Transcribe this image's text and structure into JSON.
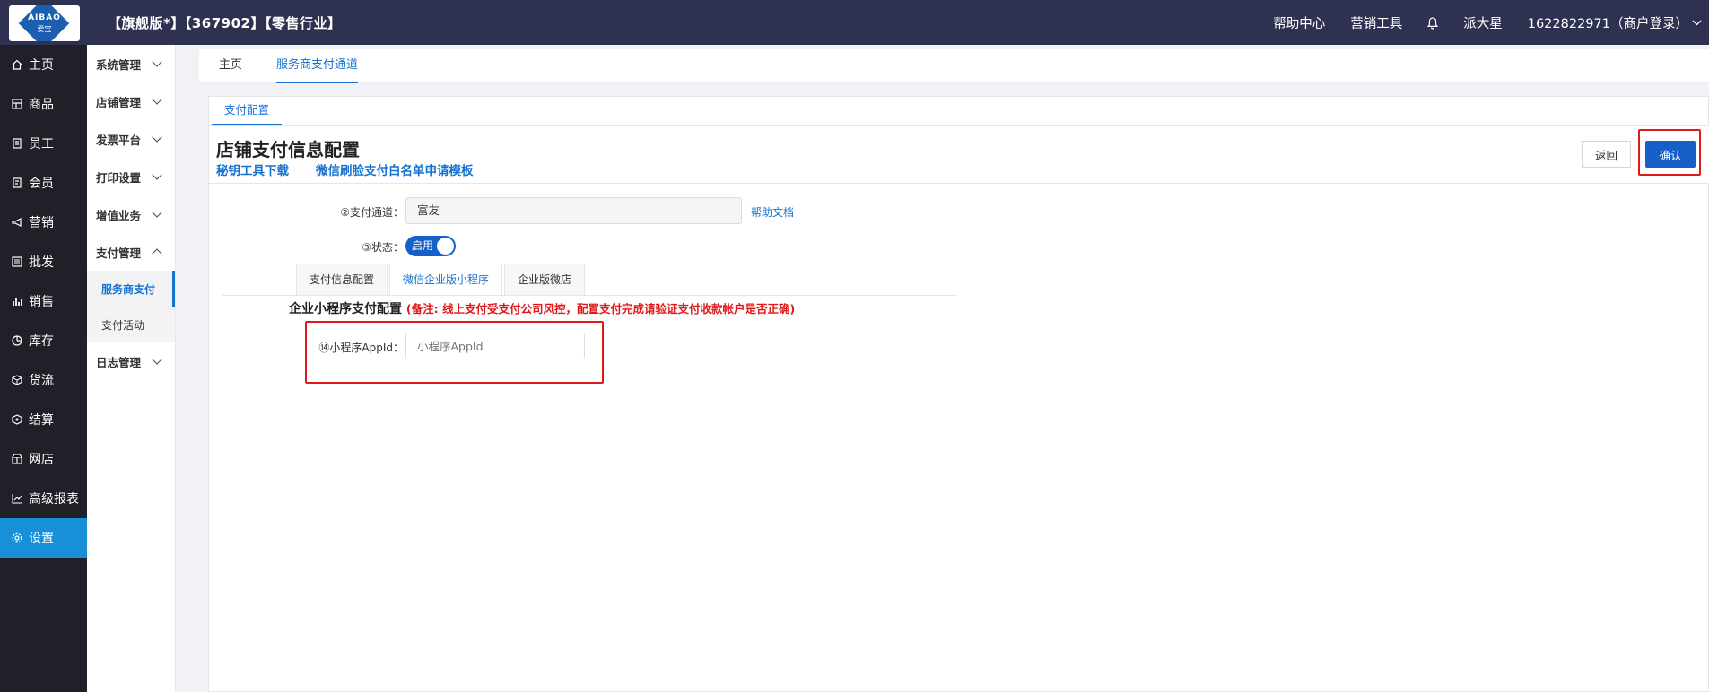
{
  "topbar": {
    "logo_text": "AIBAO",
    "logo_sub": "爱宝",
    "title": "【旗舰版*】【367902】【零售行业】",
    "help_center": "帮助中心",
    "marketing_tools": "营销工具",
    "user_name": "派大星",
    "account": "1622822971（商户登录）"
  },
  "sidebar": {
    "items": [
      {
        "label": "主页",
        "icon": "home-icon"
      },
      {
        "label": "商品",
        "icon": "product-icon"
      },
      {
        "label": "员工",
        "icon": "staff-icon"
      },
      {
        "label": "会员",
        "icon": "member-icon"
      },
      {
        "label": "营销",
        "icon": "megaphone-icon"
      },
      {
        "label": "批发",
        "icon": "list-icon"
      },
      {
        "label": "销售",
        "icon": "bar-chart-icon"
      },
      {
        "label": "库存",
        "icon": "pie-icon"
      },
      {
        "label": "货流",
        "icon": "box-icon"
      },
      {
        "label": "结算",
        "icon": "settle-icon"
      },
      {
        "label": "网店",
        "icon": "shop-icon"
      },
      {
        "label": "高级报表",
        "icon": "line-chart-icon"
      },
      {
        "label": "设置",
        "icon": "gear-icon"
      }
    ],
    "active_index": 12
  },
  "submenu": {
    "groups": [
      {
        "label": "系统管理"
      },
      {
        "label": "店铺管理"
      },
      {
        "label": "发票平台"
      },
      {
        "label": "打印设置"
      },
      {
        "label": "增值业务"
      },
      {
        "label": "支付管理"
      },
      {
        "label": "日志管理"
      }
    ],
    "pay_children": [
      "服务商支付",
      "支付活动"
    ]
  },
  "tabbar": {
    "home": "主页",
    "current": "服务商支付通道"
  },
  "subtab": "支付配置",
  "header": {
    "title": "店铺支付信息配置",
    "link1": "秘钥工具下载",
    "link2": "微信刷脸支付白名单申请模板",
    "back": "返回",
    "confirm": "确认"
  },
  "form": {
    "channel_label": "②支付通道：",
    "channel_value": "富友",
    "help_link": "帮助文档",
    "status_label": "③状态：",
    "status_value": "启用",
    "tabs": [
      "支付信息配置",
      "微信企业版小程序",
      "企业版微店"
    ],
    "active_tab": 1,
    "section_title": "企业小程序支付配置",
    "section_note": "(备注: 线上支付受支付公司风控，配置支付完成请验证支付收款帐户是否正确)",
    "appid_label": "⑭小程序AppId：",
    "appid_placeholder": "小程序AppId"
  }
}
